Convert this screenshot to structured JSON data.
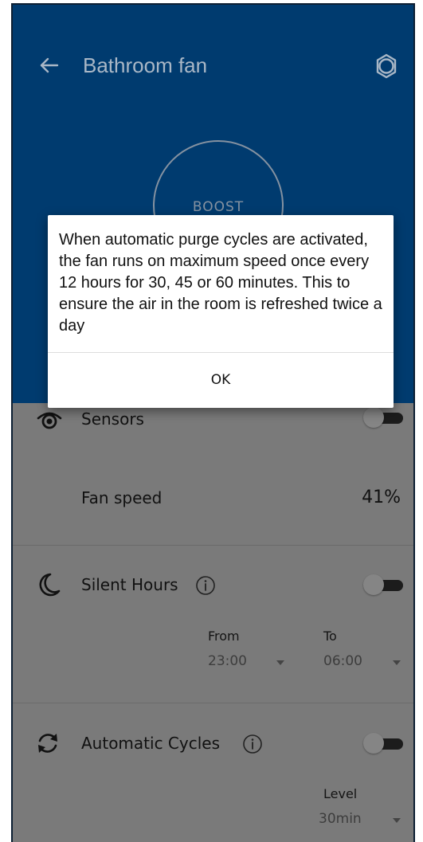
{
  "header": {
    "title": "Bathroom fan",
    "back_icon": "back-arrow-icon",
    "settings_icon": "gear-icon",
    "boost_label": "BOOST"
  },
  "sensors": {
    "label": "Sensors",
    "icon": "eye-icon",
    "enabled": false
  },
  "fan_speed": {
    "label": "Fan speed",
    "value": "41%"
  },
  "silent_hours": {
    "label": "Silent Hours",
    "icon": "moon-icon",
    "enabled": false,
    "from_label": "From",
    "from_value": "23:00",
    "to_label": "To",
    "to_value": "06:00"
  },
  "automatic_cycles": {
    "label": "Automatic Cycles",
    "icon": "refresh-icon",
    "enabled": false,
    "level_label": "Level",
    "level_value": "30min"
  },
  "dialog": {
    "message": "When automatic purge cycles are activated, the fan runs on maximum speed once every 12 hours for 30, 45 or 60 minutes. This to ensure the air in the room is refreshed twice a day",
    "ok_label": "OK"
  },
  "colors": {
    "header_bg": "#003b6f",
    "overlay_bg": "#7a7a7a",
    "dialog_bg": "#ffffff"
  }
}
